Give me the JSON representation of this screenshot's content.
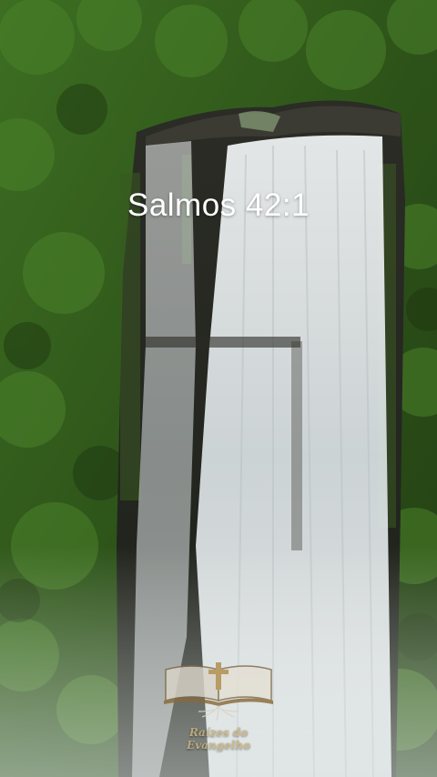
{
  "verse": {
    "reference": "Salmos 42:1"
  },
  "logo": {
    "text": "Raízes do Evangelho",
    "icon": "bible-cross-roots-icon"
  },
  "colors": {
    "foliage": "#2f5a1c",
    "rock": "#2a2a22",
    "water": "#e6ecef",
    "text": "#ffffff",
    "logo_text": "#c9b27c"
  }
}
